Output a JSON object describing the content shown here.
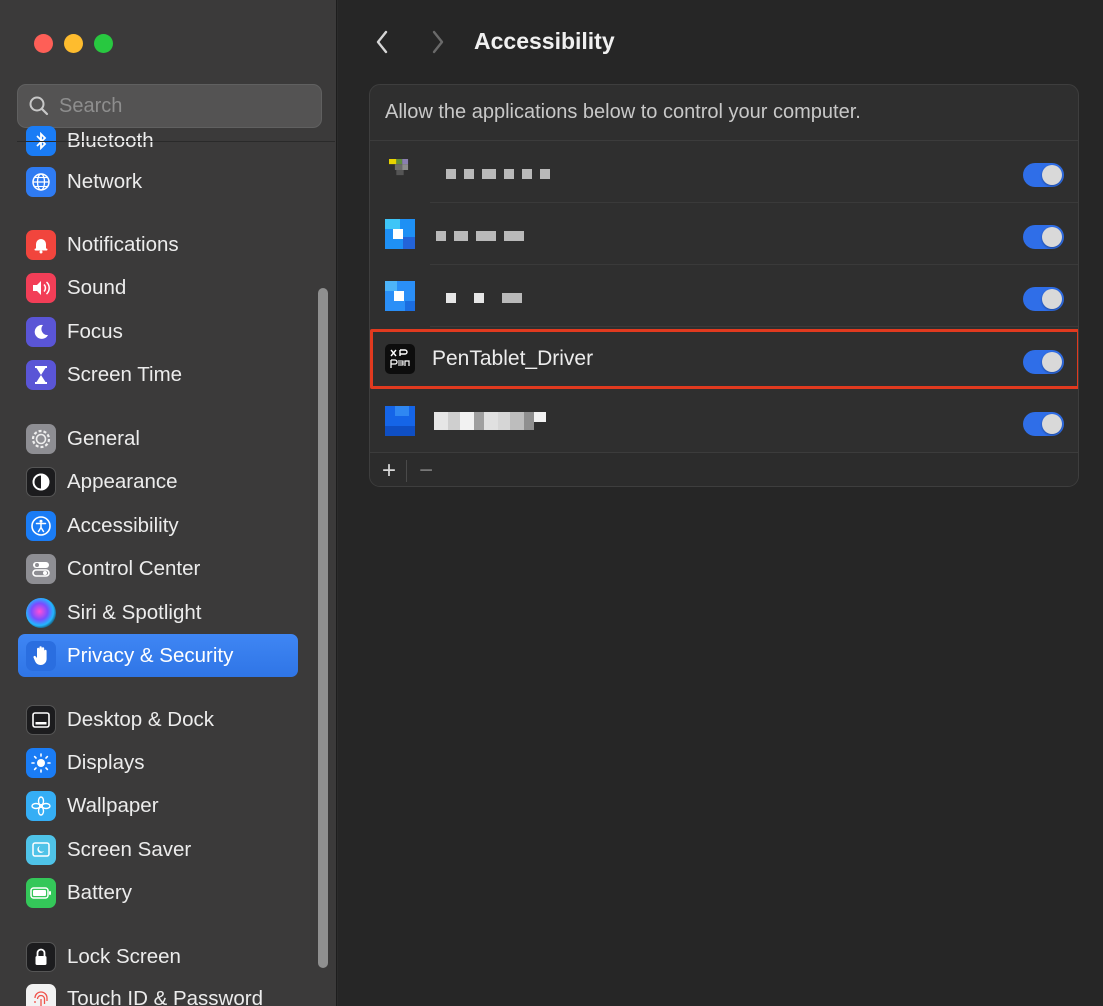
{
  "window": {
    "traffic_lights": [
      "close",
      "minimize",
      "maximize"
    ]
  },
  "search": {
    "placeholder": "Search"
  },
  "sidebar": {
    "items": [
      {
        "label": "Bluetooth",
        "icon": "bluetooth-icon",
        "color": "#1a7cf5"
      },
      {
        "label": "Network",
        "icon": "globe-icon",
        "color": "#2f7bf2"
      },
      {
        "label": "Notifications",
        "icon": "bell-icon",
        "color": "#f1453d"
      },
      {
        "label": "Sound",
        "icon": "speaker-icon",
        "color": "#f23e57"
      },
      {
        "label": "Focus",
        "icon": "moon-icon",
        "color": "#5a55d6"
      },
      {
        "label": "Screen Time",
        "icon": "hourglass-icon",
        "color": "#5a55d6"
      },
      {
        "label": "General",
        "icon": "gear-icon",
        "color": "#8e8e93"
      },
      {
        "label": "Appearance",
        "icon": "appearance-icon",
        "color": "#1c1c1e"
      },
      {
        "label": "Accessibility",
        "icon": "accessibility-icon",
        "color": "#1a7cf5"
      },
      {
        "label": "Control Center",
        "icon": "toggles-icon",
        "color": "#8e8e93"
      },
      {
        "label": "Siri & Spotlight",
        "icon": "siri-icon",
        "color": "#2b2b2b"
      },
      {
        "label": "Privacy & Security",
        "icon": "hand-icon",
        "color": "#2f75e6",
        "selected": true
      },
      {
        "label": "Desktop & Dock",
        "icon": "dock-icon",
        "color": "#1c1c1e"
      },
      {
        "label": "Displays",
        "icon": "sun-icon",
        "color": "#1a7cf5"
      },
      {
        "label": "Wallpaper",
        "icon": "flower-icon",
        "color": "#35aef5"
      },
      {
        "label": "Screen Saver",
        "icon": "screensaver-icon",
        "color": "#4fc3e8"
      },
      {
        "label": "Battery",
        "icon": "battery-icon",
        "color": "#34c759"
      },
      {
        "label": "Lock Screen",
        "icon": "lock-icon",
        "color": "#1c1c1e"
      },
      {
        "label": "Touch ID & Password",
        "icon": "fingerprint-icon",
        "color": "#f2f2f2"
      }
    ]
  },
  "main": {
    "title": "Accessibility",
    "caption": "Allow the applications below to control your computer.",
    "apps": [
      {
        "name": "",
        "redacted": true,
        "enabled": true,
        "icon": "redacted-app-icon-1"
      },
      {
        "name": "",
        "redacted": true,
        "enabled": true,
        "icon": "redacted-app-icon-2"
      },
      {
        "name": "",
        "redacted": true,
        "enabled": true,
        "icon": "redacted-app-icon-3"
      },
      {
        "name": "PenTablet_Driver",
        "redacted": false,
        "enabled": true,
        "icon": "xp-pen-icon",
        "highlighted": true
      },
      {
        "name": "",
        "redacted": true,
        "enabled": true,
        "icon": "redacted-app-icon-5"
      }
    ],
    "footer": {
      "add_label": "+",
      "remove_label": "−"
    }
  },
  "colors": {
    "accent": "#2f6ee8",
    "highlight_box": "#e13a1f",
    "sidebar_bg": "#3b3a3a",
    "main_bg": "#262626"
  }
}
